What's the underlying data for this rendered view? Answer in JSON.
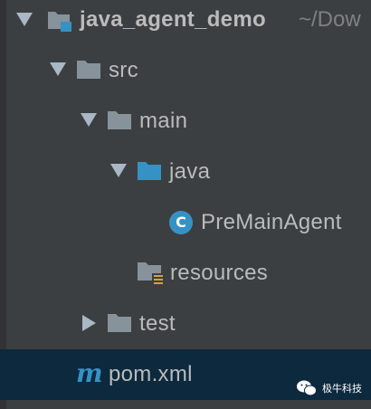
{
  "project_tree": {
    "root": {
      "label": "java_agent_demo",
      "path": "~/Dow",
      "icon": "module-folder-icon"
    },
    "nodes": [
      {
        "label": "src",
        "icon": "folder-icon",
        "expanded": true
      },
      {
        "label": "main",
        "icon": "folder-icon",
        "expanded": true
      },
      {
        "label": "java",
        "icon": "source-folder-icon",
        "expanded": true
      },
      {
        "label": "PreMainAgent",
        "icon": "java-class-icon",
        "glyph": "C"
      },
      {
        "label": "resources",
        "icon": "resources-folder-icon"
      },
      {
        "label": "test",
        "icon": "folder-icon",
        "expanded": false
      },
      {
        "label": "pom.xml",
        "icon": "maven-file-icon",
        "glyph": "m",
        "selected": true
      }
    ]
  },
  "watermark": {
    "text": "极牛科技"
  },
  "colors": {
    "background": "#3c3f41",
    "selection": "#0d293e",
    "text": "#bbbbbb",
    "path_text": "#808080",
    "folder": "#87939a",
    "source_folder": "#3592c4",
    "accent": "#3592c4"
  }
}
